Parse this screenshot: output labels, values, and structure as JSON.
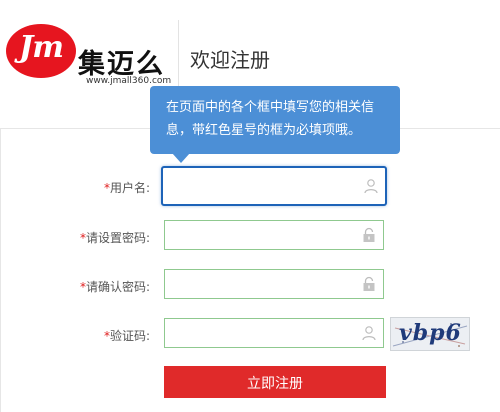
{
  "logo": {
    "badge": "Jm",
    "name": "集迈么",
    "url": "www.jmall360.com"
  },
  "header": {
    "title": "欢迎注册"
  },
  "tip": {
    "text": "在页面中的各个框中填写您的相关信息，带红色星号的框为必填项哦。"
  },
  "form": {
    "required_mark": "*",
    "fields": [
      {
        "label": "用户名:",
        "value": "",
        "icon": "user-icon"
      },
      {
        "label": "请设置密码:",
        "value": "",
        "icon": "lock-icon"
      },
      {
        "label": "请确认密码:",
        "value": "",
        "icon": "lock-icon"
      },
      {
        "label": "验证码:",
        "value": "",
        "icon": "user-icon"
      }
    ],
    "captcha": "vbp6",
    "submit_label": "立即注册"
  },
  "colors": {
    "brand": "#e6151f",
    "tip": "#4c8fd6",
    "focus": "#1d63b8",
    "valid_border": "#8fc98f",
    "submit": "#e02a2a"
  }
}
